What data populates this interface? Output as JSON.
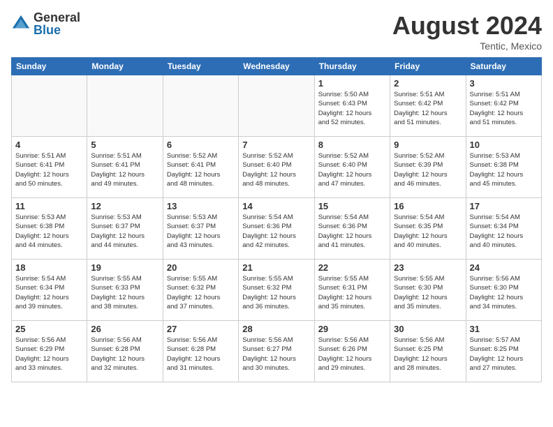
{
  "header": {
    "logo_general": "General",
    "logo_blue": "Blue",
    "month_year": "August 2024",
    "location": "Tentic, Mexico"
  },
  "days_of_week": [
    "Sunday",
    "Monday",
    "Tuesday",
    "Wednesday",
    "Thursday",
    "Friday",
    "Saturday"
  ],
  "weeks": [
    [
      {
        "day": "",
        "info": ""
      },
      {
        "day": "",
        "info": ""
      },
      {
        "day": "",
        "info": ""
      },
      {
        "day": "",
        "info": ""
      },
      {
        "day": "1",
        "info": "Sunrise: 5:50 AM\nSunset: 6:43 PM\nDaylight: 12 hours\nand 52 minutes."
      },
      {
        "day": "2",
        "info": "Sunrise: 5:51 AM\nSunset: 6:42 PM\nDaylight: 12 hours\nand 51 minutes."
      },
      {
        "day": "3",
        "info": "Sunrise: 5:51 AM\nSunset: 6:42 PM\nDaylight: 12 hours\nand 51 minutes."
      }
    ],
    [
      {
        "day": "4",
        "info": "Sunrise: 5:51 AM\nSunset: 6:41 PM\nDaylight: 12 hours\nand 50 minutes."
      },
      {
        "day": "5",
        "info": "Sunrise: 5:51 AM\nSunset: 6:41 PM\nDaylight: 12 hours\nand 49 minutes."
      },
      {
        "day": "6",
        "info": "Sunrise: 5:52 AM\nSunset: 6:41 PM\nDaylight: 12 hours\nand 48 minutes."
      },
      {
        "day": "7",
        "info": "Sunrise: 5:52 AM\nSunset: 6:40 PM\nDaylight: 12 hours\nand 48 minutes."
      },
      {
        "day": "8",
        "info": "Sunrise: 5:52 AM\nSunset: 6:40 PM\nDaylight: 12 hours\nand 47 minutes."
      },
      {
        "day": "9",
        "info": "Sunrise: 5:52 AM\nSunset: 6:39 PM\nDaylight: 12 hours\nand 46 minutes."
      },
      {
        "day": "10",
        "info": "Sunrise: 5:53 AM\nSunset: 6:38 PM\nDaylight: 12 hours\nand 45 minutes."
      }
    ],
    [
      {
        "day": "11",
        "info": "Sunrise: 5:53 AM\nSunset: 6:38 PM\nDaylight: 12 hours\nand 44 minutes."
      },
      {
        "day": "12",
        "info": "Sunrise: 5:53 AM\nSunset: 6:37 PM\nDaylight: 12 hours\nand 44 minutes."
      },
      {
        "day": "13",
        "info": "Sunrise: 5:53 AM\nSunset: 6:37 PM\nDaylight: 12 hours\nand 43 minutes."
      },
      {
        "day": "14",
        "info": "Sunrise: 5:54 AM\nSunset: 6:36 PM\nDaylight: 12 hours\nand 42 minutes."
      },
      {
        "day": "15",
        "info": "Sunrise: 5:54 AM\nSunset: 6:36 PM\nDaylight: 12 hours\nand 41 minutes."
      },
      {
        "day": "16",
        "info": "Sunrise: 5:54 AM\nSunset: 6:35 PM\nDaylight: 12 hours\nand 40 minutes."
      },
      {
        "day": "17",
        "info": "Sunrise: 5:54 AM\nSunset: 6:34 PM\nDaylight: 12 hours\nand 40 minutes."
      }
    ],
    [
      {
        "day": "18",
        "info": "Sunrise: 5:54 AM\nSunset: 6:34 PM\nDaylight: 12 hours\nand 39 minutes."
      },
      {
        "day": "19",
        "info": "Sunrise: 5:55 AM\nSunset: 6:33 PM\nDaylight: 12 hours\nand 38 minutes."
      },
      {
        "day": "20",
        "info": "Sunrise: 5:55 AM\nSunset: 6:32 PM\nDaylight: 12 hours\nand 37 minutes."
      },
      {
        "day": "21",
        "info": "Sunrise: 5:55 AM\nSunset: 6:32 PM\nDaylight: 12 hours\nand 36 minutes."
      },
      {
        "day": "22",
        "info": "Sunrise: 5:55 AM\nSunset: 6:31 PM\nDaylight: 12 hours\nand 35 minutes."
      },
      {
        "day": "23",
        "info": "Sunrise: 5:55 AM\nSunset: 6:30 PM\nDaylight: 12 hours\nand 35 minutes."
      },
      {
        "day": "24",
        "info": "Sunrise: 5:56 AM\nSunset: 6:30 PM\nDaylight: 12 hours\nand 34 minutes."
      }
    ],
    [
      {
        "day": "25",
        "info": "Sunrise: 5:56 AM\nSunset: 6:29 PM\nDaylight: 12 hours\nand 33 minutes."
      },
      {
        "day": "26",
        "info": "Sunrise: 5:56 AM\nSunset: 6:28 PM\nDaylight: 12 hours\nand 32 minutes."
      },
      {
        "day": "27",
        "info": "Sunrise: 5:56 AM\nSunset: 6:28 PM\nDaylight: 12 hours\nand 31 minutes."
      },
      {
        "day": "28",
        "info": "Sunrise: 5:56 AM\nSunset: 6:27 PM\nDaylight: 12 hours\nand 30 minutes."
      },
      {
        "day": "29",
        "info": "Sunrise: 5:56 AM\nSunset: 6:26 PM\nDaylight: 12 hours\nand 29 minutes."
      },
      {
        "day": "30",
        "info": "Sunrise: 5:56 AM\nSunset: 6:25 PM\nDaylight: 12 hours\nand 28 minutes."
      },
      {
        "day": "31",
        "info": "Sunrise: 5:57 AM\nSunset: 6:25 PM\nDaylight: 12 hours\nand 27 minutes."
      }
    ]
  ]
}
